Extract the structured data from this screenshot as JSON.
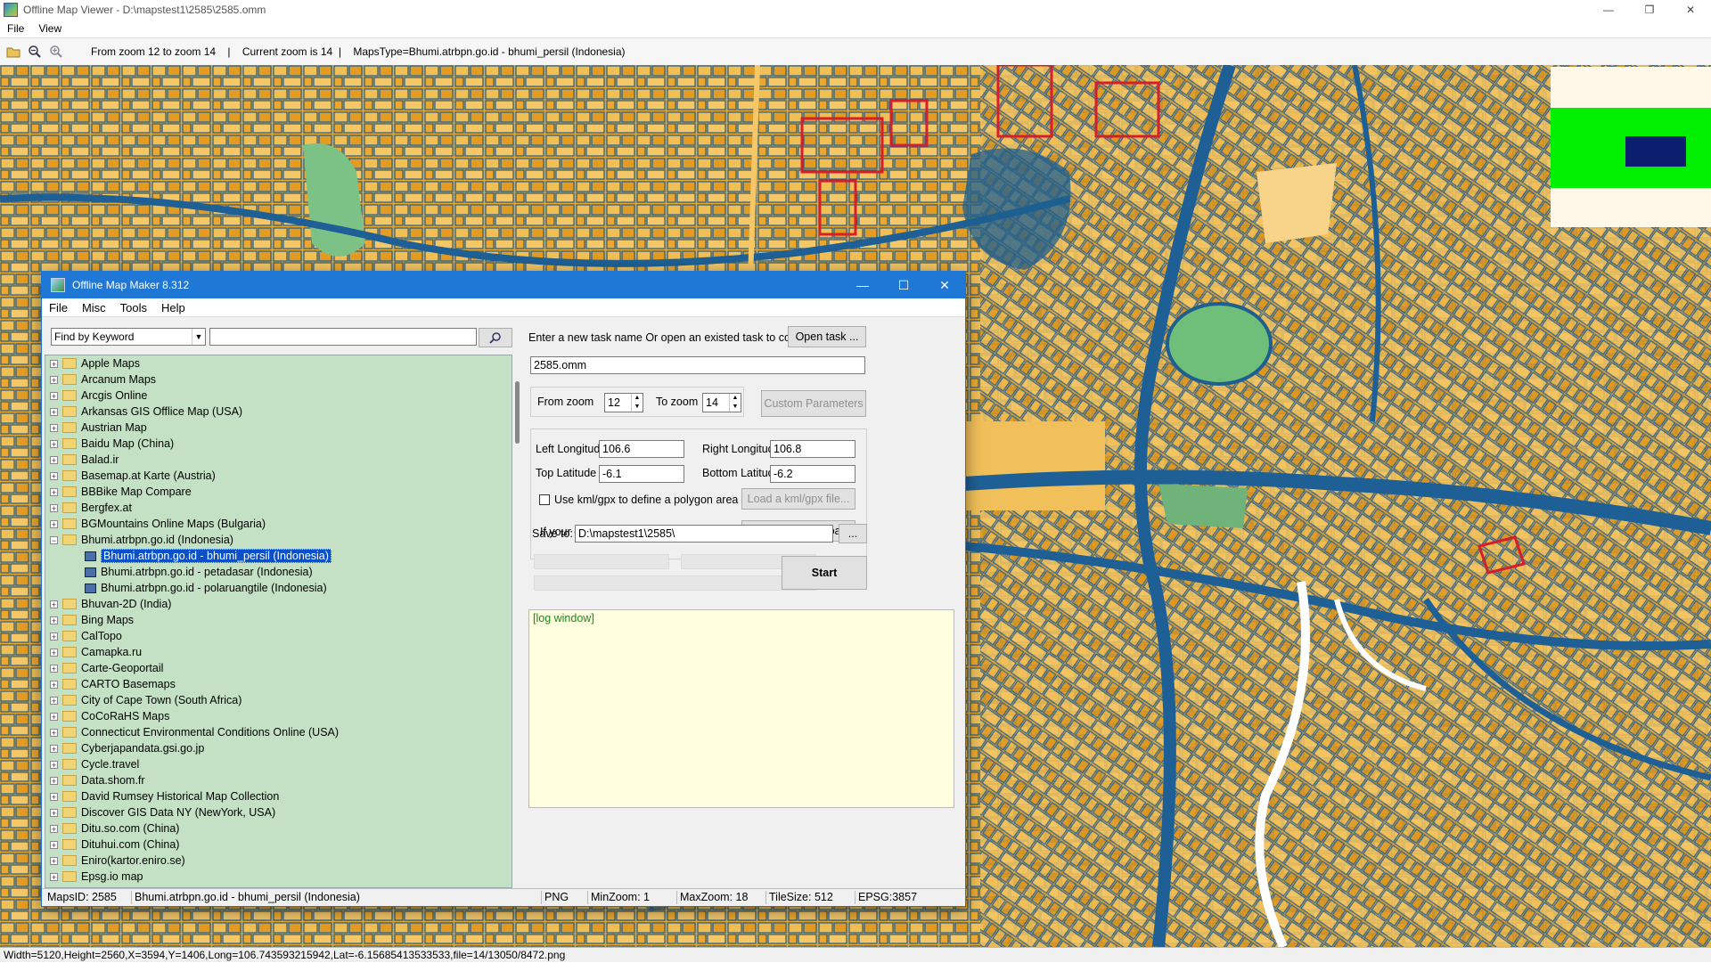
{
  "window": {
    "title": "Offline Map Viewer - D:\\mapstest1\\2585\\2585.omm",
    "controls": {
      "minimize": "—",
      "restore": "❐",
      "close": "✕"
    }
  },
  "menu": [
    "File",
    "View"
  ],
  "toolbar": {
    "info": "From zoom 12 to zoom 14    |    Current zoom is 14  |    MapsType=Bhumi.atrbpn.go.id - bhumi_persil (Indonesia)"
  },
  "status": {
    "text": "Width=5120,Height=2560,X=3594,Y=1406,Long=106.743593215942,Lat=-6.15685413533533,file=14/13050/8472.png"
  },
  "minimap_colors": {
    "background": "#fff8e8",
    "viewport": "#00f000",
    "marker": "#0c1e6e"
  },
  "dialog": {
    "title": "Offline Map Maker 8.312",
    "controls": {
      "minimize": "—",
      "maximize": "☐",
      "close": "✕"
    },
    "menu": [
      "File",
      "Misc",
      "Tools",
      "Help"
    ],
    "find": {
      "mode": "Find by Keyword",
      "query": ""
    },
    "tree": [
      {
        "label": "Apple Maps",
        "type": "folder"
      },
      {
        "label": "Arcanum Maps",
        "type": "folder"
      },
      {
        "label": "Arcgis Online",
        "type": "folder"
      },
      {
        "label": "Arkansas GIS Offlice Map (USA)",
        "type": "folder"
      },
      {
        "label": "Austrian Map",
        "type": "folder"
      },
      {
        "label": "Baidu Map (China)",
        "type": "folder"
      },
      {
        "label": "Balad.ir",
        "type": "folder"
      },
      {
        "label": "Basemap.at Karte (Austria)",
        "type": "folder"
      },
      {
        "label": "BBBike Map Compare",
        "type": "folder"
      },
      {
        "label": "Bergfex.at",
        "type": "folder"
      },
      {
        "label": "BGMountains Online Maps (Bulgaria)",
        "type": "folder"
      },
      {
        "label": "Bhumi.atrbpn.go.id (Indonesia)",
        "type": "folder-open"
      },
      {
        "label": "Bhumi.atrbpn.go.id - bhumi_persil (Indonesia)",
        "type": "map",
        "selected": true
      },
      {
        "label": "Bhumi.atrbpn.go.id - petadasar (Indonesia)",
        "type": "map"
      },
      {
        "label": "Bhumi.atrbpn.go.id - polaruangtile (Indonesia)",
        "type": "map"
      },
      {
        "label": "Bhuvan-2D (India)",
        "type": "folder"
      },
      {
        "label": "Bing Maps",
        "type": "folder"
      },
      {
        "label": "CalTopo",
        "type": "folder"
      },
      {
        "label": "Camapka.ru",
        "type": "folder"
      },
      {
        "label": "Carte-Geoportail",
        "type": "folder"
      },
      {
        "label": "CARTO Basemaps",
        "type": "folder"
      },
      {
        "label": "City of Cape Town (South Africa)",
        "type": "folder"
      },
      {
        "label": "CoCoRaHS Maps",
        "type": "folder"
      },
      {
        "label": "Connecticut Environmental Conditions Online (USA)",
        "type": "folder"
      },
      {
        "label": "Cyberjapandata.gsi.go.jp",
        "type": "folder"
      },
      {
        "label": "Cycle.travel",
        "type": "folder"
      },
      {
        "label": "Data.shom.fr",
        "type": "folder"
      },
      {
        "label": "David Rumsey Historical Map Collection",
        "type": "folder"
      },
      {
        "label": "Discover GIS Data NY (NewYork, USA)",
        "type": "folder"
      },
      {
        "label": "Ditu.so.com (China)",
        "type": "folder"
      },
      {
        "label": "Dituhui.com (China)",
        "type": "folder"
      },
      {
        "label": "Eniro(kartor.eniro.se)",
        "type": "folder"
      },
      {
        "label": "Epsg.io map",
        "type": "folder"
      }
    ],
    "task": {
      "prompt": "Enter a new task name Or open an existed task to continue:",
      "open_button": "Open task ...",
      "name": "2585.omm"
    },
    "zoom": {
      "from_label": "From zoom",
      "from_value": "12",
      "to_label": "To zoom",
      "to_value": "14",
      "custom_button": "Custom Parameters"
    },
    "coords": {
      "left_label": "Left Longitude",
      "left_value": "106.6",
      "right_label": "Right Longitude",
      "right_value": "106.8",
      "top_label": "Top Latitude",
      "top_value": "-6.1",
      "bottom_label": "Bottom Latitude",
      "bottom_value": "-6.2",
      "kml_label": "Use kml/gpx to define a polygon area",
      "kml_button": "Load a kml/gpx file...",
      "clipboard_label": "If your clipboard contains coordinates values:",
      "clipboard_button": "Paste from Clipboard"
    },
    "save": {
      "label": "Save to:",
      "path": "D:\\mapstest1\\2585\\",
      "browse": "..."
    },
    "start_button": "Start",
    "log": "[log window]",
    "statusbar": {
      "maps_id": "MapsID: 2585",
      "name": "Bhumi.atrbpn.go.id - bhumi_persil (Indonesia)",
      "format": "PNG",
      "min_zoom": "MinZoom: 1",
      "max_zoom": "MaxZoom: 18",
      "tile_size": "TileSize: 512",
      "epsg": "EPSG:3857"
    }
  }
}
